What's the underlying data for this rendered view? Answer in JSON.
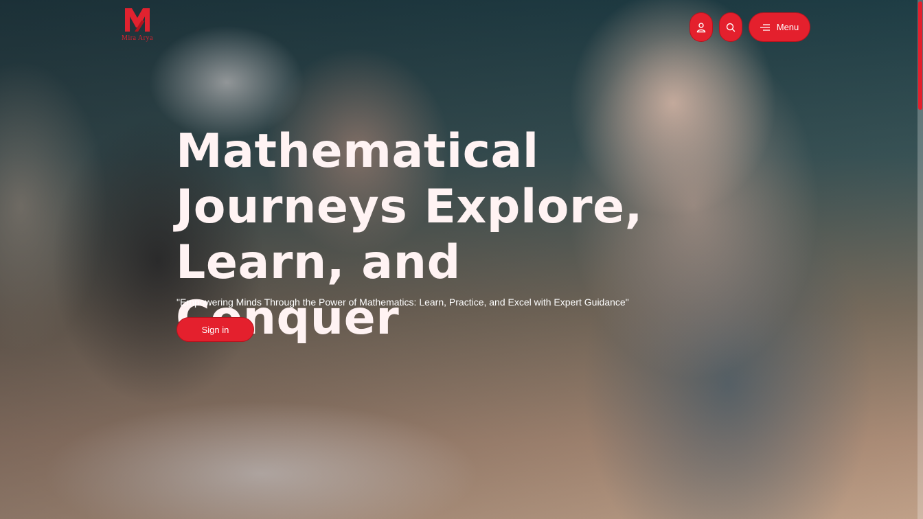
{
  "header": {
    "logo_text": "Mira Arya",
    "menu_label": "Menu",
    "icons": [
      "user-icon",
      "search-icon",
      "menu-lines-icon"
    ]
  },
  "hero": {
    "title": "Mathematical Journeys Explore, Learn, and Conquer",
    "subtitle": "\"Empowering Minds Through the Power of Mathematics: Learn, Practice, and Excel with Expert Guidance\"",
    "cta_label": "Sign in"
  },
  "colors": {
    "accent": "#e4202d",
    "title_text": "#fff3f3"
  }
}
